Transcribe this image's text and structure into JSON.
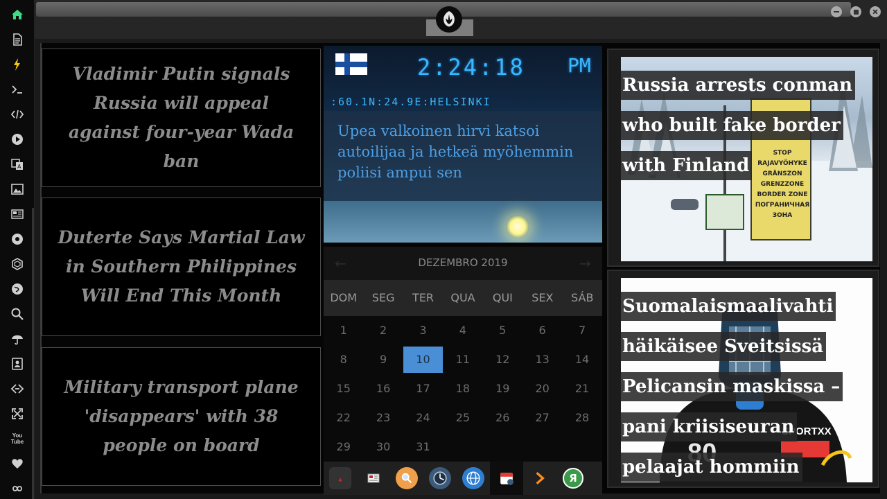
{
  "dock": {
    "items": [
      {
        "name": "home-icon",
        "color": "#3ddc84"
      },
      {
        "name": "document-icon"
      },
      {
        "name": "lightning-icon",
        "color": "#f5c518"
      },
      {
        "name": "terminal-icon"
      },
      {
        "name": "code-icon"
      },
      {
        "name": "play-icon"
      },
      {
        "name": "translate-icon"
      },
      {
        "name": "image-icon"
      },
      {
        "name": "news-icon"
      },
      {
        "name": "settings-icon"
      },
      {
        "name": "hexagon-icon"
      },
      {
        "name": "globe-icon"
      },
      {
        "name": "search-icon"
      },
      {
        "name": "umbrella-icon"
      },
      {
        "name": "contacts-icon"
      },
      {
        "name": "link-icon"
      },
      {
        "name": "expand-icon"
      },
      {
        "name": "youtube-icon",
        "label": "You\nTube"
      },
      {
        "name": "heart-icon"
      },
      {
        "name": "infinity-icon"
      }
    ]
  },
  "news": [
    {
      "title": "Vladimir Putin signals Russia will appeal against four-year Wada ban"
    },
    {
      "title": "Duterte Says Martial Law in Southern Philippines Will End This Month"
    },
    {
      "title": "Military transport plane 'disappears' with 38 people on board"
    }
  ],
  "weather": {
    "time": "2:24:18",
    "ampm": "PM",
    "location": ":60.1N:24.9E:HELSINKI",
    "headline": "Upea valkoinen hirvi katsoi autoilijaa ja hetkeä myöhemmin poliisi ampui sen"
  },
  "calendar": {
    "month": "DEZEMBRO 2019",
    "weekdays": [
      "DOM",
      "SEG",
      "TER",
      "QUA",
      "QUI",
      "SEX",
      "SÁB"
    ],
    "weeks": [
      [
        "1",
        "2",
        "3",
        "4",
        "5",
        "6",
        "7"
      ],
      [
        "8",
        "9",
        "10",
        "11",
        "12",
        "13",
        "14"
      ],
      [
        "15",
        "16",
        "17",
        "18",
        "19",
        "20",
        "21"
      ],
      [
        "22",
        "23",
        "24",
        "25",
        "26",
        "27",
        "28"
      ],
      [
        "29",
        "30",
        "31",
        "",
        "",
        "",
        ""
      ]
    ],
    "today": "10",
    "today_color": "#4a8fd6"
  },
  "apps": [
    {
      "name": "app-launcher-icon",
      "color": "#c62828"
    },
    {
      "name": "newspaper-icon",
      "color": "#d8d8d8"
    },
    {
      "name": "search-app-icon",
      "color": "#f0a04b"
    },
    {
      "name": "clock-app-icon",
      "color": "#3c5a7a"
    },
    {
      "name": "web-browser-icon",
      "color": "#2e7fd1"
    },
    {
      "name": "calendar-app-icon",
      "color": "#e53935"
    },
    {
      "name": "arrow-app-icon",
      "color": "#ff8c1a"
    },
    {
      "name": "yandex-icon",
      "color": "#3a9a4a",
      "label": "Я"
    }
  ],
  "headlines": [
    {
      "title": "Russia arrests conman who built fake border with Finland",
      "sign_text": "STOP\nRAJAVYÖHYKE\nGRÄNSZON\nGRENZZONE\nBORDER ZONE\nПОГРАНИЧНАЯ ЗОНА"
    },
    {
      "title": "Suomalaismaalivahti häikäisee Sveitsissä Pelicansin maskissa – pani kriisiseuran pelaajat hommiin",
      "jersey_text": "SPORTXX"
    }
  ]
}
